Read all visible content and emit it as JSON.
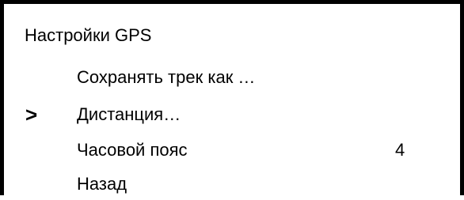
{
  "title": "Настройки GPS",
  "cursor_symbol": ">",
  "items": [
    {
      "label": "Сохранять трек как …",
      "value": ""
    },
    {
      "label": "Дистанция…",
      "value": ""
    },
    {
      "label": "Часовой пояс",
      "value": "4"
    },
    {
      "label": "Назад",
      "value": ""
    }
  ],
  "selected_index": 1
}
